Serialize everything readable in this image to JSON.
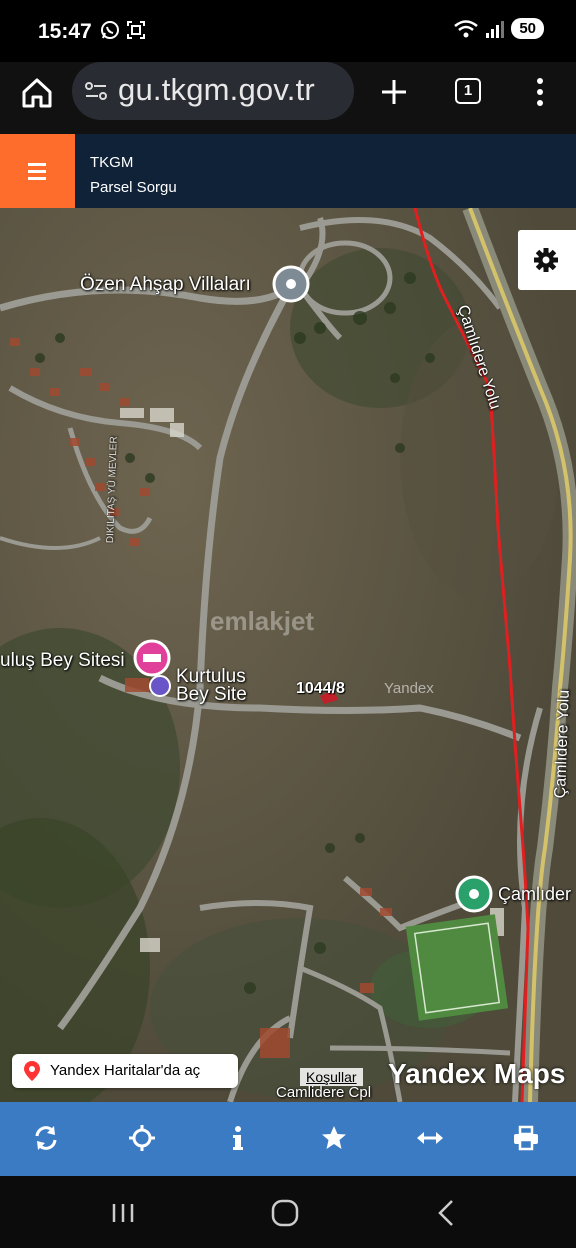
{
  "status_bar": {
    "time": "15:47",
    "battery": "50",
    "icons_left": [
      "whatsapp-icon",
      "screenshot-icon"
    ],
    "icons_right": [
      "wifi-icon",
      "signal-icon"
    ]
  },
  "browser": {
    "url": "gu.tkgm.gov.tr",
    "tab_count": "1",
    "icons": [
      "home-icon",
      "site-settings-icon",
      "new-tab-icon",
      "more-icon"
    ]
  },
  "app_header": {
    "title": "TKGM",
    "subtitle": "Parsel Sorgu",
    "accent_color": "#ff6d2d",
    "header_color": "#0f2238"
  },
  "map": {
    "labels": {
      "ozen": "Özen Ahşap Villaları",
      "kurtulus_sitesi": "uluş Bey Sitesi",
      "kurtulus_site_1": "Kurtulus",
      "kurtulus_site_2": "Bey Site",
      "street_vertical": "DIKILITAŞ YÜ MEVLER",
      "camlidere_yolu_top": "Çamlıdere Yolu",
      "camlidere_yolu_right": "Çamlıdere Yolu",
      "camlider": "Çamlıder",
      "camlidere_cpl": "Camlidere Cpl",
      "parcel": "1044/8",
      "watermark_yandex": "Yandex",
      "watermark_emlak": "emlakjet"
    },
    "open_in_yandex": "Yandex Haritalar'da aç",
    "terms": "Koşullar",
    "yandex_maps": "Yandex Maps",
    "parcel_color": "#c0202a",
    "boundary_color": "#e02020"
  },
  "toolbar": {
    "color": "#3b7bc4",
    "items": [
      "refresh-icon",
      "locate-icon",
      "info-icon",
      "favorite-icon",
      "measure-icon",
      "print-icon"
    ]
  },
  "nav": {
    "items": [
      "recents-icon",
      "home-icon",
      "back-icon"
    ]
  }
}
